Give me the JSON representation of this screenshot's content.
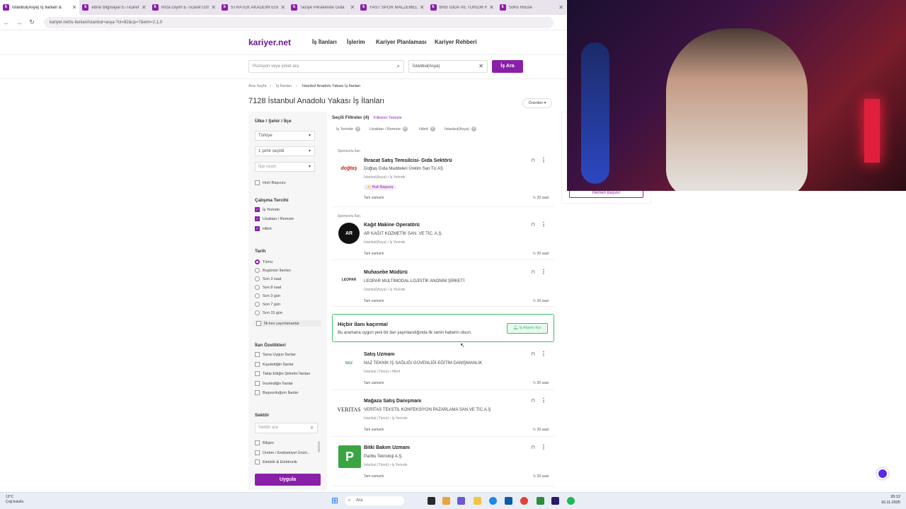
{
  "browser": {
    "tabs": [
      {
        "title": "İstanbul(Asya) İş İlanları &",
        "active": true
      },
      {
        "title": "ebrar bilgisayar E-Ticaret",
        "active": false
      },
      {
        "title": "İmza Giyim E-Ticaret Uzm",
        "active": false
      },
      {
        "title": "STRATEK AKADEMİ EĞİTİ",
        "active": false
      },
      {
        "title": "Taziye Perakende Gıda",
        "active": false
      },
      {
        "title": "FAST SPOR MALZEMELER",
        "active": false
      },
      {
        "title": "BNS GIDA VE TURİZM Hİ",
        "active": false
      },
      {
        "title": "Soho House",
        "active": false
      }
    ],
    "url": "kariyer.net/is-ilanlari/istanbul+asya-?ct=82&cp=7&wm=2,1,0"
  },
  "header": {
    "logo": "kariyer.net",
    "nav": [
      "İş İlanları",
      "İşlerim",
      "Kariyer Planlaması",
      "Kariyer Rehberi"
    ]
  },
  "search": {
    "position_placeholder": "Pozisyon veya şirket ara",
    "location_value": "İstanbul(Asya)",
    "button": "İş Ara"
  },
  "breadcrumb": [
    "Ana Sayfa",
    "İş İlanları",
    "İstanbul Anadolu Yakası İş İlanları"
  ],
  "page_title": "7128 İstanbul Anadolu Yakası İş İlanları",
  "sort": "Önerilen",
  "filters": {
    "location_heading": "Ülke / Şehir / İlçe",
    "country": "Türkiye",
    "city": "1 şehir seçildi",
    "district": "İlçe seçin",
    "fast_apply": "Hızlı Başvuru",
    "work_pref_heading": "Çalışma Tercihi",
    "work_pref": [
      {
        "label": "İş Yerinde",
        "checked": true
      },
      {
        "label": "Uzaktan / Remote",
        "checked": true
      },
      {
        "label": "Hibrit",
        "checked": true
      }
    ],
    "date_heading": "Tarih",
    "date_options": [
      {
        "label": "Tümü",
        "selected": true
      },
      {
        "label": "Bugünün İlanları",
        "selected": false
      },
      {
        "label": "Son 3 saat",
        "selected": false
      },
      {
        "label": "Son 8 saat",
        "selected": false
      },
      {
        "label": "Son 3 gün",
        "selected": false
      },
      {
        "label": "Son 7 gün",
        "selected": false
      },
      {
        "label": "Son 15 gün",
        "selected": false
      }
    ],
    "first_time": "İlk kez yayınlananlar",
    "features_heading": "İlan Özellikleri",
    "features": [
      "Sana Uygun İlanlar",
      "Kaydettiğin İlanlar",
      "Takip Ettiğin Şirketin İlanları",
      "İncelediğin İlanlar",
      "Başvurduğum İlanlar"
    ],
    "sector_heading": "Sektör",
    "sector_placeholder": "Sektör ara",
    "sectors": [
      "Bilişim",
      "Üretim / Endüstriyel Ürünl...",
      "Elektrik & Elektronik"
    ],
    "apply": "Uygula"
  },
  "selected_filters": {
    "label": "Seçili Filtreler (4)",
    "clear": "Filtreleri Temizle",
    "chips": [
      "İş Yerinde",
      "Uzaktan / Remote",
      "Hibrit",
      "İstanbul(Asya)"
    ]
  },
  "jobs": [
    {
      "sponsored": "Sponsorlu İlan",
      "logo": "doğtaş",
      "title": "İhracat Satış Temsilcisi- Gıda Sektörü",
      "company": "Doğtaş Gıda Maddeleri Üretim San Tic AŞ",
      "location": "İstanbul(Asya) • İş Yerinde",
      "badge": "⚡ Hızlı Başvuru",
      "type": "Tam zamanlı",
      "time": "20 saat"
    },
    {
      "sponsored": "Sponsorlu İlan",
      "logo": "AR",
      "title": "Kağıt Makine Operatörü",
      "company": "AR KAĞIT KOZMETİK SAN. VE TİC. A.Ş.",
      "location": "İstanbul(Asya) • İş Yerinde",
      "badge": "",
      "type": "Tam zamanlı",
      "time": "20 saat"
    },
    {
      "sponsored": "",
      "logo": "LEOPAR",
      "title": "Muhasebe Müdürü",
      "company": "LEOPAR MULTIMODAL LOJİSTİK ANONİM ŞİRKETİ",
      "location": "İstanbul(Asya) • İş Yerinde",
      "badge": "",
      "type": "Tam zamanlı",
      "time": "20 saat"
    },
    {
      "sponsored": "",
      "logo": "NAZ",
      "title": "Satış Uzmanı",
      "company": "NAZ TEKNİK İŞ SAĞLIĞI GÜVENLİĞİ EĞİTİM DANIŞMANLIK",
      "location": "İstanbul (Tümü) • Hibrit",
      "badge": "",
      "type": "Tam zamanlı",
      "time": "20 saat"
    },
    {
      "sponsored": "",
      "logo": "VERITAS",
      "title": "Mağaza Satış Danışmanı",
      "company": "VERİTAS TEKSTİL KONFEKSİYON PAZARLAMA SAN.VE TİC.A.Ş",
      "location": "İstanbul (Tümü) • İş Yerinde",
      "badge": "",
      "type": "Tam zamanlı",
      "time": "20 saat"
    },
    {
      "sponsored": "",
      "logo": "P",
      "title": "Bitki Bakım Uzmanı",
      "company": "Paribu Teknoloji A.Ş.",
      "location": "İstanbul (Tümü) • İş Yerinde",
      "badge": "",
      "type": "Tam zamanlı",
      "time": "20 saat"
    }
  ],
  "alert": {
    "title": "Hiçbir ilanı kaçırma!",
    "text": "Bu aramana uygun yeni bir ilan yayınlandığında ilk senin haberin olsun.",
    "button": "İş Alarmı Kur"
  },
  "right_panel": {
    "apply_now": "Hemen Başvur"
  },
  "taskbar": {
    "temp": "13°C",
    "weather": "Çoğ bulutlu",
    "search": "Ara",
    "time": "20:12",
    "date": "16.11.2025"
  }
}
